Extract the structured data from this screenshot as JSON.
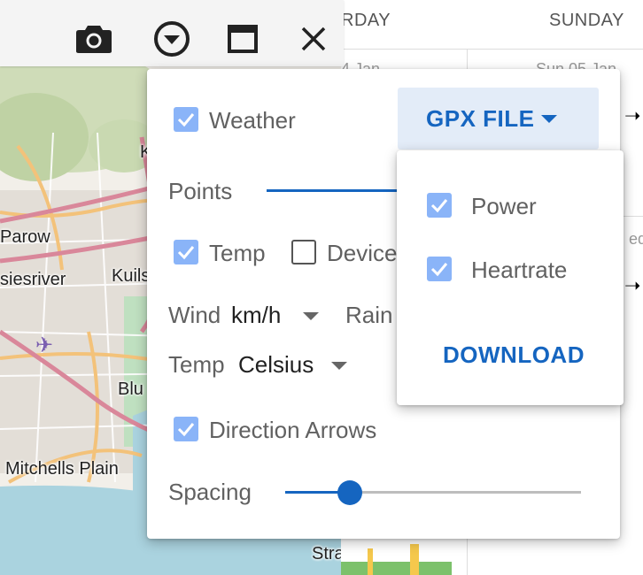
{
  "toolbar": {
    "icons": [
      "camera-icon",
      "dropdown-circle-icon",
      "maximize-icon",
      "close-icon"
    ]
  },
  "map": {
    "labels": [
      "Parow",
      "siesriver",
      "Kuils",
      "Blu",
      "Mitchells Plain",
      "Stra",
      "K"
    ]
  },
  "calendar": {
    "days": [
      "RDAY",
      "SUNDAY"
    ],
    "dates": [
      "4 Jan",
      "Sun 05 Jan",
      "ed"
    ]
  },
  "panel": {
    "weather": {
      "label": "Weather",
      "checked": true
    },
    "gpx_button": {
      "label": "GPX FILE"
    },
    "points": {
      "label": "Points"
    },
    "temp_check": {
      "label": "Temp",
      "checked": true
    },
    "device_check": {
      "label": "Device",
      "checked": false
    },
    "wind": {
      "label": "Wind",
      "value": "km/h"
    },
    "rain": {
      "label": "Rain"
    },
    "temp_unit": {
      "label": "Temp",
      "value": "Celsius"
    },
    "direction_arrows": {
      "label": "Direction Arrows",
      "checked": true
    },
    "spacing": {
      "label": "Spacing",
      "slider_fraction": 0.22
    }
  },
  "gpx_menu": {
    "items": [
      {
        "label": "Power",
        "checked": true
      },
      {
        "label": "Heartrate",
        "checked": true
      }
    ],
    "download_label": "DOWNLOAD"
  },
  "colors": {
    "accent": "#1565c0",
    "checkbox": "#8ab4f8",
    "map_water": "#aad3df",
    "map_land": "#f2efe9"
  }
}
